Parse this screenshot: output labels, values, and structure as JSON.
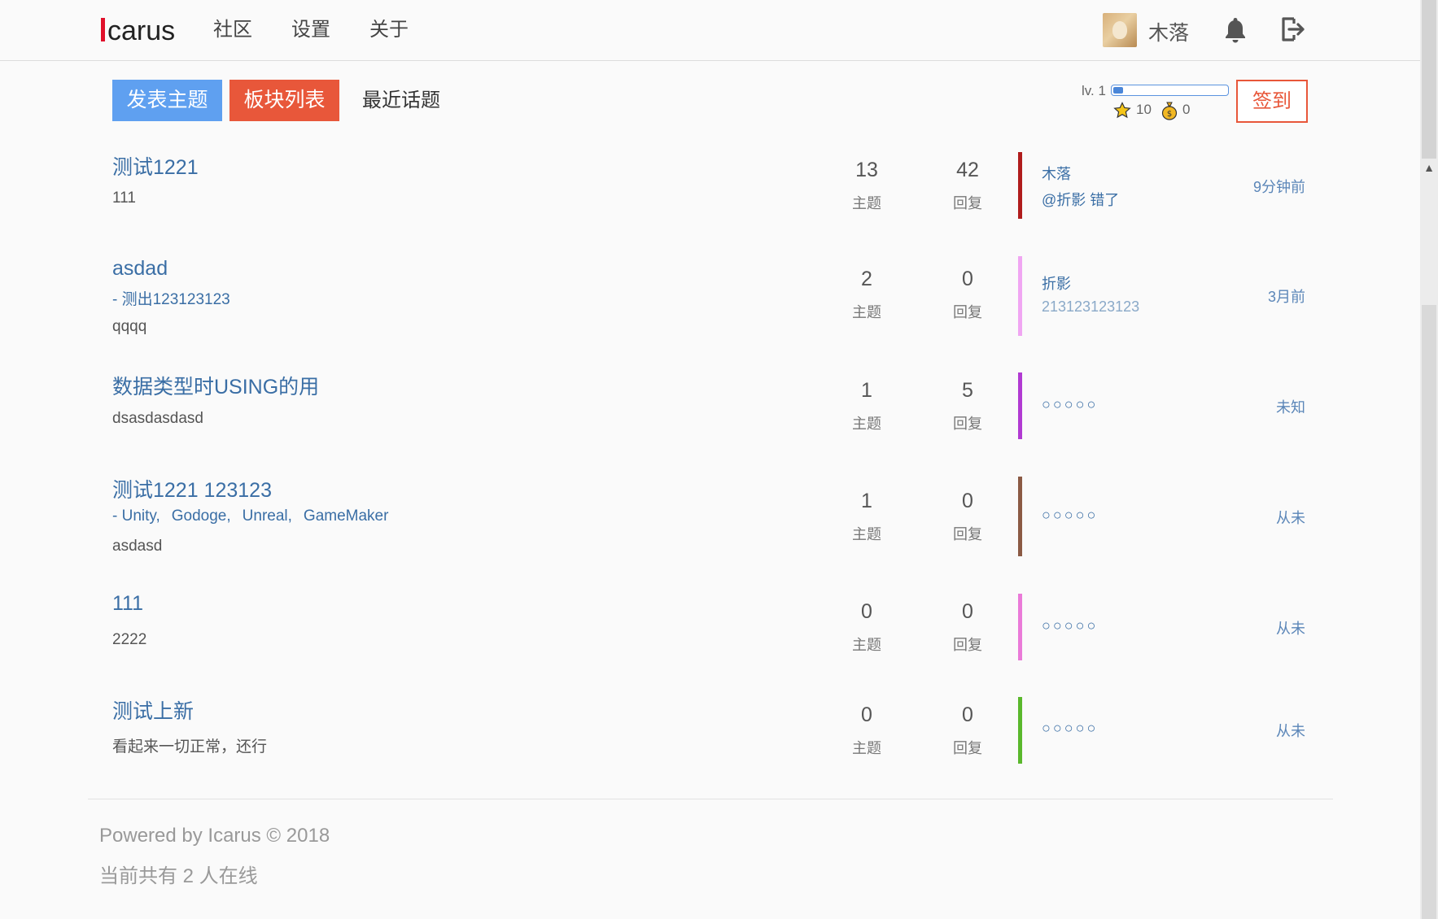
{
  "header": {
    "logo_text": "carus",
    "nav": [
      "社区",
      "设置",
      "关于"
    ],
    "username": "木落"
  },
  "toolbar": {
    "post_label": "发表主题",
    "boards_label": "板块列表",
    "recent_label": "最近话题"
  },
  "user_panel": {
    "level_label": "lv. 1",
    "level_progress": 0.08,
    "stars": "10",
    "coins": "0",
    "checkin_label": "签到"
  },
  "labels": {
    "topics": "主题",
    "replies": "回复"
  },
  "boards": [
    {
      "title": "测试1221",
      "subs": [],
      "desc": "111",
      "topics": "13",
      "replies": "42",
      "color": "#b01c1c",
      "last_user": "木落",
      "last_text": "@折影 错了",
      "time": "9分钟前"
    },
    {
      "title": "asdad",
      "subs": [
        "- 测出123123123"
      ],
      "desc": "qqqq",
      "topics": "2",
      "replies": "0",
      "color": "#f0a6f2",
      "last_user": "折影",
      "last_text": "213123123123",
      "time": "3月前"
    },
    {
      "title": "数据类型时USING的用",
      "subs": [],
      "desc": "dsasdasdasd",
      "topics": "1",
      "replies": "5",
      "color": "#b13ad2",
      "last_user": "",
      "last_text": "○○○○○",
      "time": "未知"
    },
    {
      "title": "测试1221 123123",
      "subs": [
        "- Unity,",
        "Godoge,",
        "Unreal,",
        "GameMaker"
      ],
      "desc": "asdasd",
      "topics": "1",
      "replies": "0",
      "color": "#8b5a44",
      "last_user": "",
      "last_text": "○○○○○",
      "time": "从未"
    },
    {
      "title": "111",
      "subs": [],
      "desc": "2222",
      "topics": "0",
      "replies": "0",
      "color": "#ea7ad8",
      "last_user": "",
      "last_text": "○○○○○",
      "time": "从未"
    },
    {
      "title": "测试上新",
      "subs": [],
      "desc": "看起来一切正常，还行",
      "topics": "0",
      "replies": "0",
      "color": "#5ab82c",
      "last_user": "",
      "last_text": "○○○○○",
      "time": "从未"
    }
  ],
  "footer": {
    "powered": "Powered by Icarus © 2018",
    "online": "当前共有 2 人在线"
  }
}
